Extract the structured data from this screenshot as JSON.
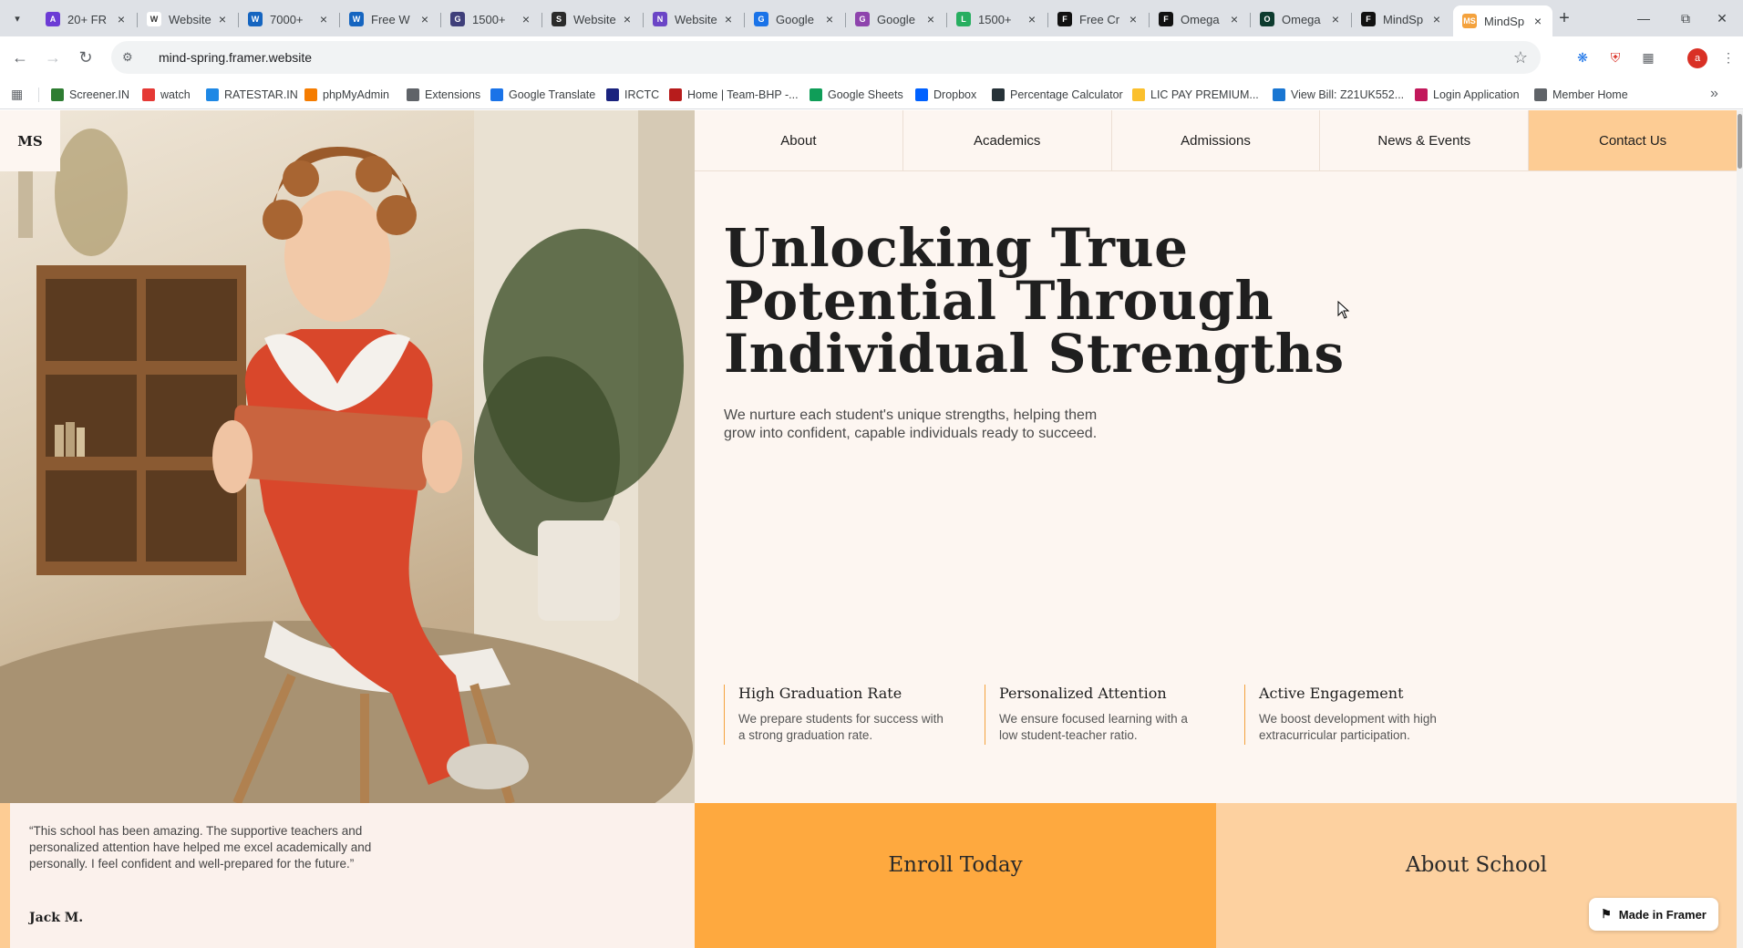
{
  "browser": {
    "tabs": [
      {
        "title": "20+ FR",
        "favicon_color": "#6c3bd5",
        "glyph": "A"
      },
      {
        "title": "Website",
        "favicon_color": "#ffffff",
        "glyph": "W"
      },
      {
        "title": "7000+",
        "favicon_color": "#1565c0",
        "glyph": "W"
      },
      {
        "title": "Free W",
        "favicon_color": "#1565c0",
        "glyph": "W"
      },
      {
        "title": "1500+",
        "favicon_color": "#3f3f7a",
        "glyph": "G"
      },
      {
        "title": "Website",
        "favicon_color": "#2b2b2b",
        "glyph": "S"
      },
      {
        "title": "Website",
        "favicon_color": "#6b45c6",
        "glyph": "N"
      },
      {
        "title": "Google",
        "favicon_color": "#1a73e8",
        "glyph": "G"
      },
      {
        "title": "Google",
        "favicon_color": "#8e44ad",
        "glyph": "G"
      },
      {
        "title": "1500+",
        "favicon_color": "#27ae60",
        "glyph": "L"
      },
      {
        "title": "Free Cr",
        "favicon_color": "#111111",
        "glyph": "F"
      },
      {
        "title": "Omega",
        "favicon_color": "#111111",
        "glyph": "F"
      },
      {
        "title": "Omega",
        "favicon_color": "#0d3b2e",
        "glyph": "O"
      },
      {
        "title": "MindSp",
        "favicon_color": "#111111",
        "glyph": "F"
      },
      {
        "title": "MindSp",
        "favicon_color": "#f4a23d",
        "glyph": "MS"
      }
    ],
    "active_tab_index": 14,
    "url": "mind-spring.framer.website",
    "profile_initial": "a",
    "bookmarks": [
      {
        "label": "Screener.IN",
        "color": "#2e7d32"
      },
      {
        "label": "watch",
        "color": "#e53935"
      },
      {
        "label": "RATESTAR.IN",
        "color": "#1e88e5"
      },
      {
        "label": "phpMyAdmin",
        "color": "#f57c00"
      },
      {
        "label": "Extensions",
        "color": "#5f6368"
      },
      {
        "label": "Google Translate",
        "color": "#1a73e8"
      },
      {
        "label": "IRCTC",
        "color": "#1a237e"
      },
      {
        "label": "Home | Team-BHP -...",
        "color": "#b71c1c"
      },
      {
        "label": "Google Sheets",
        "color": "#0f9d58"
      },
      {
        "label": "Dropbox",
        "color": "#0061ff"
      },
      {
        "label": "Percentage Calculator",
        "color": "#263238"
      },
      {
        "label": "LIC PAY PREMIUM...",
        "color": "#fbc02d"
      },
      {
        "label": "View Bill: Z21UK552...",
        "color": "#1976d2"
      },
      {
        "label": "Login Application",
        "color": "#c2185b"
      },
      {
        "label": "Member Home",
        "color": "#5f6368"
      }
    ]
  },
  "site": {
    "logo": "MS",
    "nav": [
      "About",
      "Academics",
      "Admissions",
      "News & Events",
      "Contact Us"
    ],
    "hero": {
      "title": "Unlocking True Potential Through Individual Strengths",
      "subtitle": "We nurture each student's unique strengths, helping them grow into confident, capable individuals ready to succeed."
    },
    "features": [
      {
        "title": "High Graduation Rate",
        "text": "We prepare students for success with a strong graduation rate."
      },
      {
        "title": "Personalized Attention",
        "text": "We ensure focused learning with a low student-teacher ratio."
      },
      {
        "title": "Active Engagement",
        "text": "We boost development with high extracurricular participation."
      }
    ],
    "testimonial": {
      "quote": "“This school has been amazing. The supportive teachers and personalized attention have helped me excel academically and personally. I feel confident and well-prepared for the future.”",
      "author": "Jack M."
    },
    "cta": {
      "enroll": "Enroll Today",
      "about": "About School"
    },
    "badge": "Made in Framer",
    "colors": {
      "accent_orange": "#fea93f",
      "accent_light": "#fdd1a0",
      "contact_bg": "#fdcc94",
      "page_bg": "#fdf6f1"
    }
  }
}
